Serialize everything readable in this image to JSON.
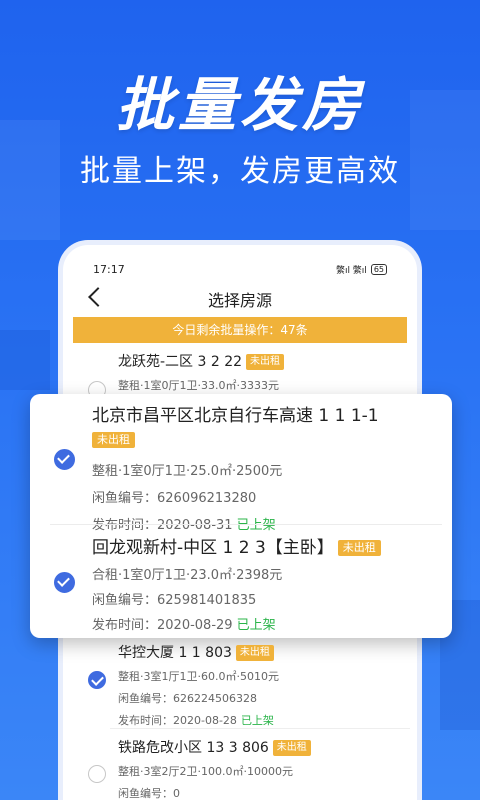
{
  "headline": "批量发房",
  "subline": "批量上架，发房更高效",
  "status_bar": {
    "time": "17:17",
    "signal": "䌘ıl 䌘ıl",
    "battery": "65"
  },
  "nav": {
    "title": "选择房源"
  },
  "quota_banner": "今日剩余批量操作：47条",
  "listings": [
    {
      "title": "龙跃苑-二区 3 2 22",
      "badge": "未出租",
      "detail": "整租·1室0厅1卫·33.0㎡·3333元"
    },
    {
      "title": "北京市昌平区北京自行车高速 1 1 1-1",
      "badge": "未出租",
      "detail": "整租·1室0厅1卫·25.0㎡·2500元",
      "xianyu_no": "闲鱼编号：626096213280",
      "publish_time": "发布时间：2020-08-31",
      "status": "已上架"
    },
    {
      "title": "回龙观新村-中区 1 2 3【主卧】",
      "badge": "未出租",
      "detail": "合租·1室0厅1卫·23.0㎡·2398元",
      "xianyu_no": "闲鱼编号：625981401835",
      "publish_time": "发布时间：2020-08-29",
      "status": "已上架"
    },
    {
      "title": "华控大厦 1 1 803",
      "badge": "未出租",
      "detail": "整租·3室1厅1卫·60.0㎡·5010元",
      "xianyu_no": "闲鱼编号：626224506328",
      "publish_time": "发布时间：2020-08-28",
      "status": "已上架"
    },
    {
      "title": "铁路危改小区 13 3 806",
      "badge": "未出租",
      "detail": "整租·3室2厅2卫·100.0㎡·10000元",
      "xianyu_no": "闲鱼编号：0"
    }
  ],
  "colors": {
    "brand_blue": "#2a73f4",
    "badge_orange": "#f0b23a",
    "check_blue": "#3f6be0",
    "listed_green": "#2bb44a"
  }
}
